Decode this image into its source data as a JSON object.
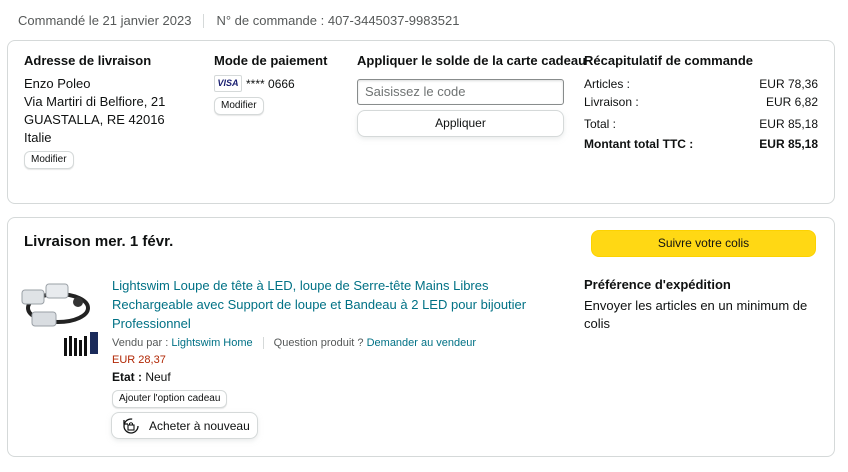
{
  "order_header": {
    "ordered_on": "Commandé le 21 janvier 2023",
    "order_number": "N° de commande : 407-3445037-9983521"
  },
  "shipping_address": {
    "heading": "Adresse de livraison",
    "lines": [
      "Enzo Poleo",
      "Via Martiri di Belfiore, 21",
      "GUASTALLA, RE 42016",
      "Italie"
    ],
    "edit_label": "Modifier"
  },
  "payment": {
    "heading": "Mode de paiement",
    "card_brand": "VISA",
    "card_masked": "**** 0666",
    "edit_label": "Modifier"
  },
  "gift_card": {
    "heading": "Appliquer le solde de la carte cadeau",
    "placeholder": "Saisissez le code",
    "apply_label": "Appliquer"
  },
  "summary": {
    "heading": "Récapitulatif de commande",
    "rows": [
      {
        "label": "Articles :",
        "value": "EUR 78,36"
      },
      {
        "label": "Livraison :",
        "value": "EUR 6,82"
      },
      {
        "label": "Total :",
        "value": "EUR 85,18"
      },
      {
        "label": "Montant total TTC :",
        "value": "EUR 85,18"
      }
    ]
  },
  "delivery": {
    "heading": "Livraison mer. 1 févr.",
    "track_label": "Suivre votre colis"
  },
  "item": {
    "title_lines": [
      "Lightswim Loupe de tête à LED, loupe de Serre-tête Mains Libres",
      "Rechargeable avec Support de loupe et Bandeau à 2 LED pour bijoutier",
      "Professionnel"
    ],
    "sold_by_prefix": "Vendu par : ",
    "seller": "Lightswim Home",
    "question_prefix": "Question produit ? ",
    "ask_seller": "Demander au vendeur",
    "price": "EUR 28,37",
    "condition_label": "Etat :",
    "condition_value": "Neuf",
    "gift_option_label": "Ajouter l'option cadeau",
    "buy_again_label": "Acheter à nouveau"
  },
  "shipping_pref": {
    "heading": "Préférence d'expédition",
    "lines": [
      "Envoyer les articles en un minimum de",
      "colis"
    ]
  },
  "colors": {
    "link": "#007185",
    "price": "#b12704",
    "track_button": "#ffd814"
  }
}
